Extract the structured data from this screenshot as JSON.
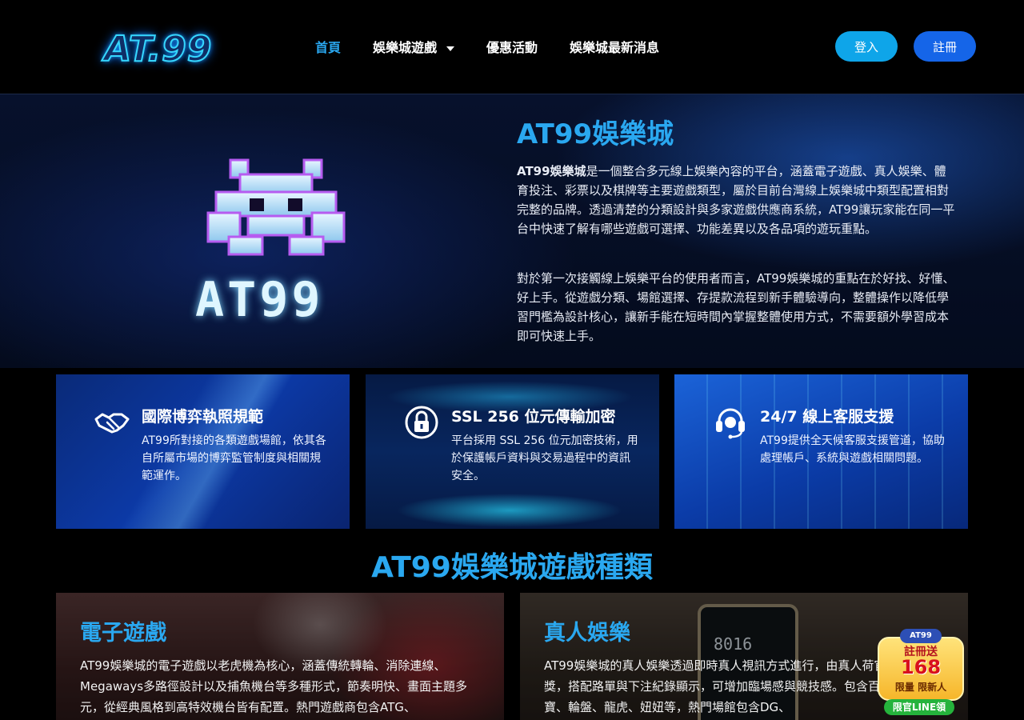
{
  "header": {
    "logo_text": "AT.99",
    "nav": {
      "home": "首頁",
      "games": "娛樂城遊戲",
      "promotions": "優惠活動",
      "news": "娛樂城最新消息"
    },
    "login_label": "登入",
    "register_label": "註冊"
  },
  "hero": {
    "logo_text": "AT99",
    "title": "AT99娛樂城",
    "p1_strong": "AT99娛樂城",
    "p1_rest": "是一個整合多元線上娛樂內容的平台，涵蓋電子遊戲、真人娛樂、體育投注、彩票以及棋牌等主要遊戲類型，屬於目前台灣線上娛樂城中類型配置相對完整的品牌。透過清楚的分類設計與多家遊戲供應商系統，AT99讓玩家能在同一平台中快速了解有哪些遊戲可選擇、功能差異以及各品項的遊玩重點。",
    "p2": "對於第一次接觸線上娛樂平台的使用者而言，AT99娛樂城的重點在於好找、好懂、好上手。從遊戲分類、場館選擇、存提款流程到新手體驗導向，整體操作以降低學習門檻為設計核心，讓新手能在短時間內掌握整體使用方式，不需要額外學習成本即可快速上手。"
  },
  "features": [
    {
      "icon": "handshake-icon",
      "title": "國際博弈執照規範",
      "text": "AT99所對接的各類遊戲場館，依其各自所屬市場的博弈監管制度與相關規範運作。"
    },
    {
      "icon": "lock-icon",
      "title": "SSL 256 位元傳輸加密",
      "text": "平台採用 SSL 256 位元加密技術，用於保護帳戶資料與交易過程中的資訊安全。"
    },
    {
      "icon": "headset-icon",
      "title": "24/7 線上客服支援",
      "text": "AT99提供全天候客服支援管道，協助處理帳戶、系統與遊戲相關問題。"
    }
  ],
  "games": {
    "section_title": "AT99娛樂城遊戲種類",
    "items": [
      {
        "title": "電子遊戲",
        "text": "AT99娛樂城的電子遊戲以老虎機為核心，涵蓋傳統轉輪、消除連線、Megaways多路徑設計以及捕魚機台等多種形式，節奏明快、畫面主題多元，從經典風格到高特效機台皆有配置。熱門遊戲商包含ATG、"
      },
      {
        "title": "真人娛樂",
        "text": "AT99娛樂城的真人娛樂透過即時真人視訊方式進行，由真人荷官發牌與開獎，搭配路單與下注紀錄顯示，可增加臨場感與競技感。包含百家樂、骰寶、輪盤、龍虎、妞妞等，熱門場館包含DG、"
      }
    ],
    "phone_display": "8016"
  },
  "promo": {
    "brand": "AT99",
    "line1": "註冊送",
    "line2": "168",
    "line3": "限量 限新人",
    "cta": "限官LINE領"
  },
  "colors": {
    "accent": "#2aa8f0",
    "login": "#0ea5e9",
    "register": "#1565e8"
  }
}
